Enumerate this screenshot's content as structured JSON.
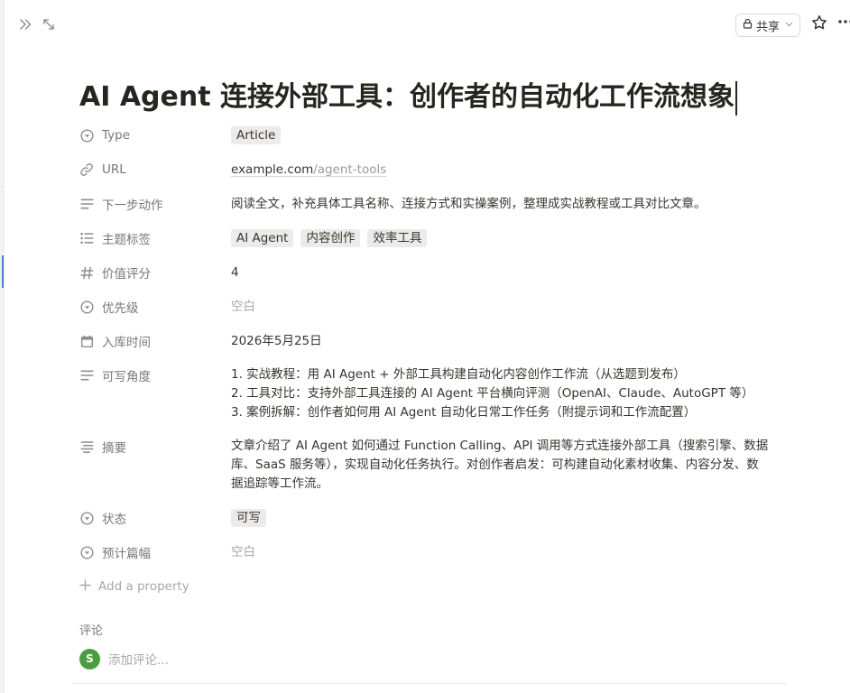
{
  "topbar": {
    "share_label": "共享",
    "icons": [
      "double-chevron-right-icon",
      "expand-arrows-icon",
      "lock-icon",
      "chevron-down-icon",
      "star-icon",
      "more-icon"
    ]
  },
  "page": {
    "title": "AI Agent 连接外部工具：创作者的自动化工作流想象"
  },
  "properties": {
    "type": {
      "name": "Type",
      "value": "Article"
    },
    "url": {
      "name": "URL",
      "host": "example.com",
      "path": "/agent-tools"
    },
    "next_action": {
      "name": "下一步动作",
      "value": "阅读全文，补充具体工具名称、连接方式和实操案例，整理成实战教程或工具对比文章。"
    },
    "topic_tags": {
      "name": "主题标签",
      "tags": [
        "AI Agent",
        "内容创作",
        "效率工具"
      ]
    },
    "value_score": {
      "name": "价值评分",
      "value": "4"
    },
    "priority": {
      "name": "优先级",
      "value": "空白"
    },
    "date_added": {
      "name": "入库时间",
      "value": "2026年5月25日"
    },
    "angles": {
      "name": "可写角度",
      "lines": [
        "1. 实战教程：用 AI Agent + 外部工具构建自动化内容创作工作流（从选题到发布）",
        "2. 工具对比：支持外部工具连接的 AI Agent 平台横向评测（OpenAI、Claude、AutoGPT 等）",
        "3. 案例拆解：创作者如何用 AI Agent 自动化日常工作任务（附提示词和工作流配置）"
      ]
    },
    "summary": {
      "name": "摘要",
      "lines": [
        "文章介绍了 AI Agent 如何通过 Function Calling、API 调用等方式连接外部工具（搜索引擎、数据",
        "库、SaaS 服务等），实现自动化任务执行。对创作者启发：可构建自动化素材收集、内容分发、数",
        "据追踪等工作流。"
      ]
    },
    "status": {
      "name": "状态",
      "value": "可写"
    },
    "estimated_length": {
      "name": "预计篇幅",
      "value": "空白"
    }
  },
  "add_property_label": "Add a property",
  "comments": {
    "label": "评论",
    "avatar_initial": "S",
    "placeholder": "添加评论..."
  },
  "colors": {
    "avatar_bg": "#4a9e3f",
    "tag_bg": "#ecebe9",
    "text_primary": "#37352f",
    "text_muted": "#787774"
  }
}
